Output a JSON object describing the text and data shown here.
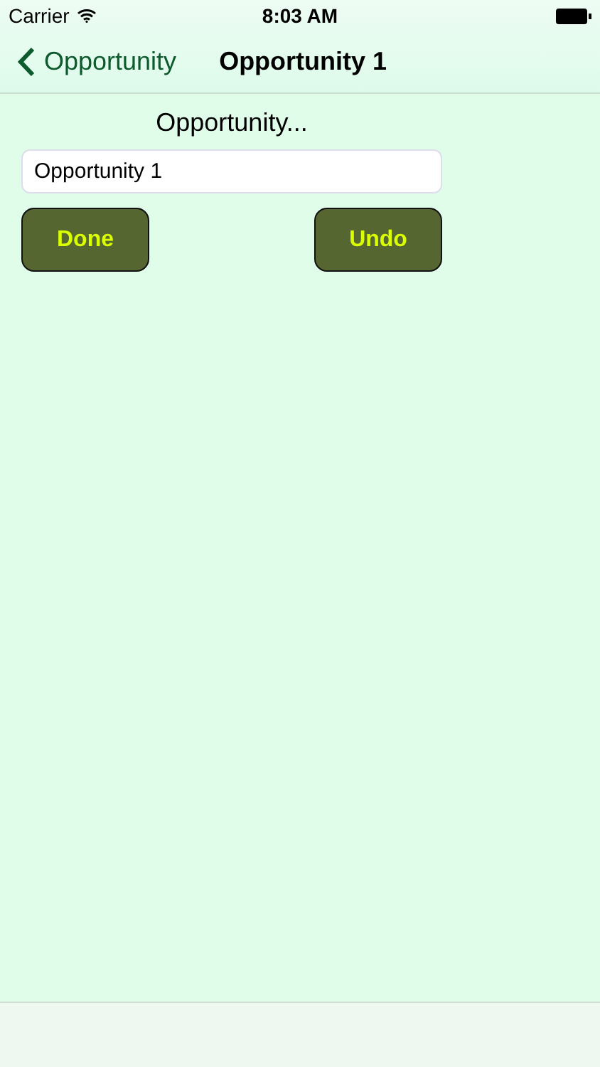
{
  "status_bar": {
    "carrier": "Carrier",
    "time": "8:03 AM"
  },
  "nav_bar": {
    "back_label": "Opportunity",
    "title": "Opportunity 1"
  },
  "form": {
    "heading": "Opportunity...",
    "field_value": "Opportunity 1"
  },
  "buttons": [
    {
      "label": "Done"
    },
    {
      "label": "Undo"
    }
  ]
}
